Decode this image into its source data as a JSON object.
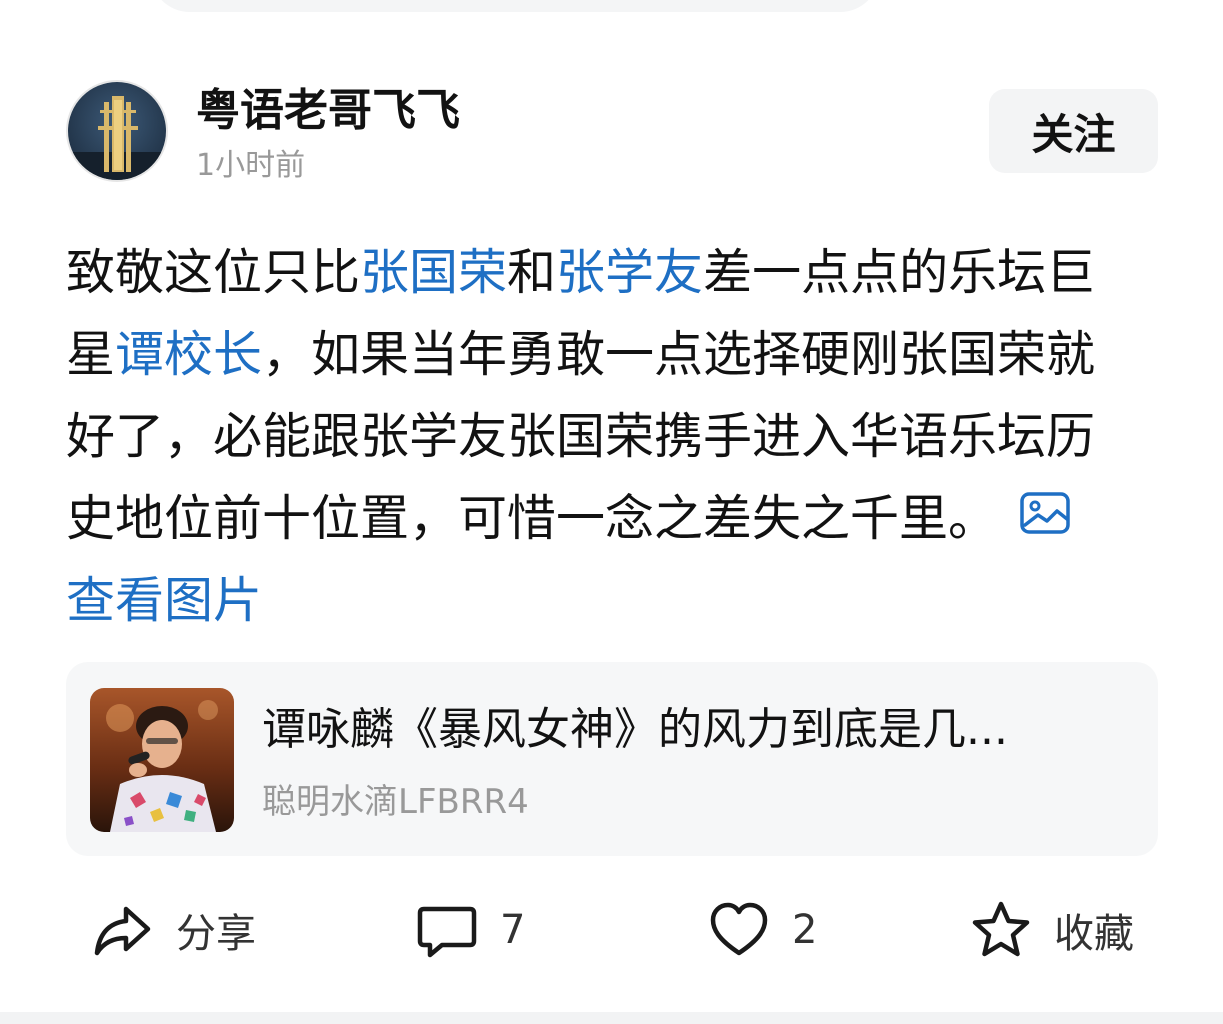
{
  "post": {
    "author": {
      "name": "粤语老哥飞飞",
      "time": "1小时前"
    },
    "follow_label": "关注",
    "text": {
      "line1_a": "致敬这位只比",
      "line1_link1": "张国荣",
      "line1_b": "和",
      "line1_link2": "张学友",
      "line1_c": "差一点点的乐坛巨",
      "line2_a": "星",
      "line2_link": "谭校长",
      "line2_b": "，如果当年勇敢一点选择硬刚张国荣就",
      "line3": "好了，必能跟张学友张国荣携手进入华语乐坛历",
      "line4": "史地位前十位置，可惜一念之差失之千里。",
      "view_images": "查看图片"
    },
    "icons": {
      "image": "image-icon"
    }
  },
  "reference_card": {
    "title": "谭咏麟《暴风女神》的风力到底是几...",
    "author": "聪明水滴LFBRR4"
  },
  "actions": {
    "share": {
      "icon": "share-icon",
      "label": "分享"
    },
    "comment": {
      "icon": "comment-icon",
      "label": "7"
    },
    "like": {
      "icon": "heart-icon",
      "label": "2"
    },
    "favorite": {
      "icon": "star-icon",
      "label": "收藏"
    }
  },
  "colors": {
    "link": "#1e6fc4",
    "text": "#121212",
    "muted": "#999999"
  }
}
